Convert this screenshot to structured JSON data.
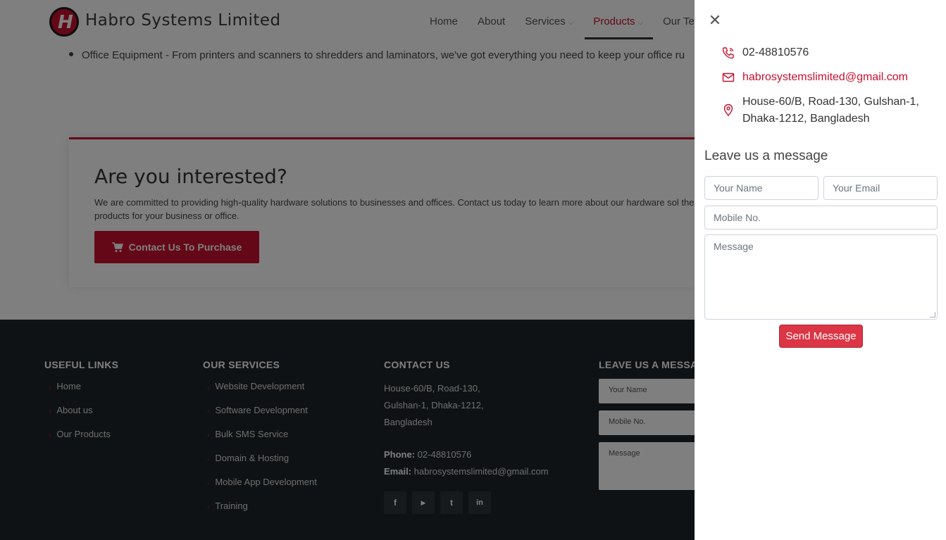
{
  "header": {
    "brand_name": "Habro Systems Limited",
    "logo_letter": "H",
    "nav": [
      {
        "label": "Home",
        "has_dropdown": false,
        "active": false
      },
      {
        "label": "About",
        "has_dropdown": false,
        "active": false
      },
      {
        "label": "Services",
        "has_dropdown": true,
        "active": false
      },
      {
        "label": "Products",
        "has_dropdown": true,
        "active": true
      },
      {
        "label": "Our Tea",
        "has_dropdown": false,
        "active": false
      }
    ],
    "chevron": "⌵"
  },
  "main": {
    "bullet_text": "Office Equipment - From printers and scanners to shredders and laminators, we've got everything you need to keep your office ru",
    "cta_title": "Are you interested?",
    "cta_text": "We are committed to providing high-quality hardware solutions to businesses and offices. Contact us today to learn more about our hardware sol the perfect products for your business or office.",
    "cta_button_label": "Contact Us To Purchase",
    "cta_icon": "cart-icon"
  },
  "footer": {
    "useful_links": {
      "heading": "USEFUL LINKS",
      "items": [
        "Home",
        "About us",
        "Our Products"
      ]
    },
    "our_services": {
      "heading": "OUR SERVICES",
      "items": [
        "Website Development",
        "Software Development",
        "Bulk SMS Service",
        "Domain & Hosting",
        "Mobile App Development",
        "Training"
      ]
    },
    "contact_us": {
      "heading": "CONTACT US",
      "address_lines": [
        "House-60/B, Road-130,",
        "Gulshan-1, Dhaka-1212,",
        "Bangladesh"
      ],
      "phone_label": "Phone:",
      "phone": "02-48810576",
      "email_label": "Email:",
      "email": "habrosystemslimited@gmail.com",
      "socials": [
        "f",
        "▶",
        "t",
        "in"
      ]
    },
    "message_form": {
      "heading": "LEAVE US A MESSAG",
      "name_placeholder": "Your Name",
      "mobile_placeholder": "Mobile No.",
      "message_placeholder": "Message"
    }
  },
  "panel": {
    "close_glyph": "✕",
    "phone": "02-48810576",
    "email": "habrosystemslimited@gmail.com",
    "address": "House-60/B, Road-130, Gulshan-1, Dhaka-1212, Bangladesh",
    "form_heading": "Leave us a message",
    "name_placeholder": "Your Name",
    "email_placeholder": "Your Email",
    "mobile_placeholder": "Mobile No.",
    "message_placeholder": "Message",
    "send_label": "Send Message"
  },
  "colors": {
    "brand_red": "#c8102e",
    "button_red": "#dc3545",
    "footer_bg": "#1f2529"
  }
}
